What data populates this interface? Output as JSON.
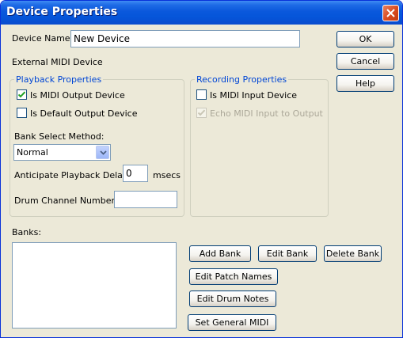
{
  "window": {
    "title": "Device Properties"
  },
  "device_name": {
    "label": "Device Name:",
    "value": "New Device"
  },
  "external_label": "External MIDI Device",
  "playback": {
    "title": "Playback Properties",
    "is_output": {
      "label": "Is MIDI Output Device",
      "checked": true
    },
    "is_default_output": {
      "label": "Is Default Output Device",
      "checked": false
    },
    "bank_select_label": "Bank Select Method:",
    "bank_select_value": "Normal",
    "anticipate_label": "Anticipate Playback Delay:",
    "anticipate_value": "0",
    "anticipate_unit": "msecs",
    "drum_channel_label": "Drum Channel Number(s):",
    "drum_channel_value": ""
  },
  "recording": {
    "title": "Recording Properties",
    "is_input": {
      "label": "Is MIDI Input Device",
      "checked": false
    },
    "echo_input": {
      "label": "Echo MIDI Input to Output",
      "checked": true,
      "disabled": true
    }
  },
  "banks": {
    "label": "Banks:",
    "add": "Add Bank",
    "edit": "Edit Bank",
    "delete": "Delete Bank",
    "edit_patch": "Edit Patch Names",
    "edit_drum": "Edit Drum Notes",
    "set_gm": "Set General MIDI"
  },
  "buttons": {
    "ok": "OK",
    "cancel": "Cancel",
    "help": "Help"
  },
  "colors": {
    "title_bar": "#0a58dc",
    "close_button": "#d84a1e",
    "group_title": "#0046d5",
    "dialog_bg": "#ece9d8"
  }
}
